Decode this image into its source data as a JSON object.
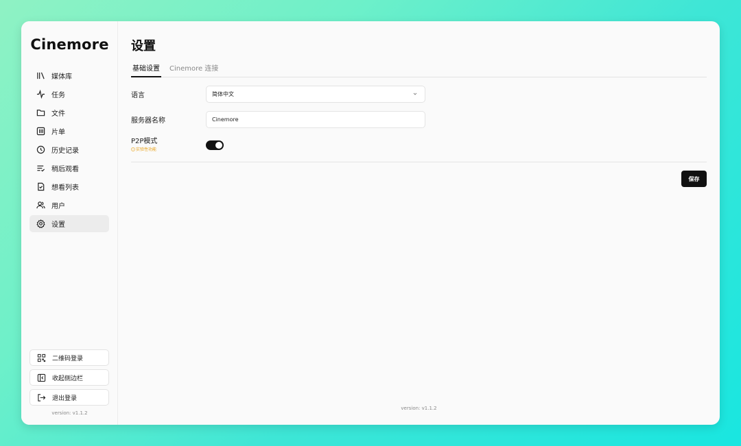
{
  "app": {
    "brand": "Cinemore"
  },
  "sidebar": {
    "items": [
      {
        "label": "媒体库",
        "icon": "library-icon",
        "active": false
      },
      {
        "label": "任务",
        "icon": "activity-icon",
        "active": false
      },
      {
        "label": "文件",
        "icon": "folder-icon",
        "active": false
      },
      {
        "label": "片单",
        "icon": "playlist-icon",
        "active": false
      },
      {
        "label": "历史记录",
        "icon": "history-icon",
        "active": false
      },
      {
        "label": "稍后观看",
        "icon": "watch-later-icon",
        "active": false
      },
      {
        "label": "想看列表",
        "icon": "wishlist-icon",
        "active": false
      },
      {
        "label": "用户",
        "icon": "users-icon",
        "active": false
      },
      {
        "label": "设置",
        "icon": "gear-icon",
        "active": true
      }
    ],
    "bottom": {
      "qr_login": "二维码登录",
      "collapse": "收起侧边栏",
      "logout": "退出登录"
    },
    "version": "version: v1.1.2"
  },
  "main": {
    "title": "设置",
    "tabs": [
      {
        "label": "基础设置",
        "active": true
      },
      {
        "label": "Cinemore 连接",
        "active": false
      }
    ],
    "settings": {
      "language": {
        "label": "语言",
        "value": "简体中文"
      },
      "server_name": {
        "label": "服务器名称",
        "value": "Cinemore"
      },
      "p2p": {
        "label": "P2P模式",
        "warning": "实验性功能",
        "enabled": true
      }
    },
    "save_label": "保存",
    "version": "version: v1.1.2"
  },
  "colors": {
    "accent": "#111111",
    "warning": "#e8a31c",
    "active_bg": "#ececec"
  }
}
